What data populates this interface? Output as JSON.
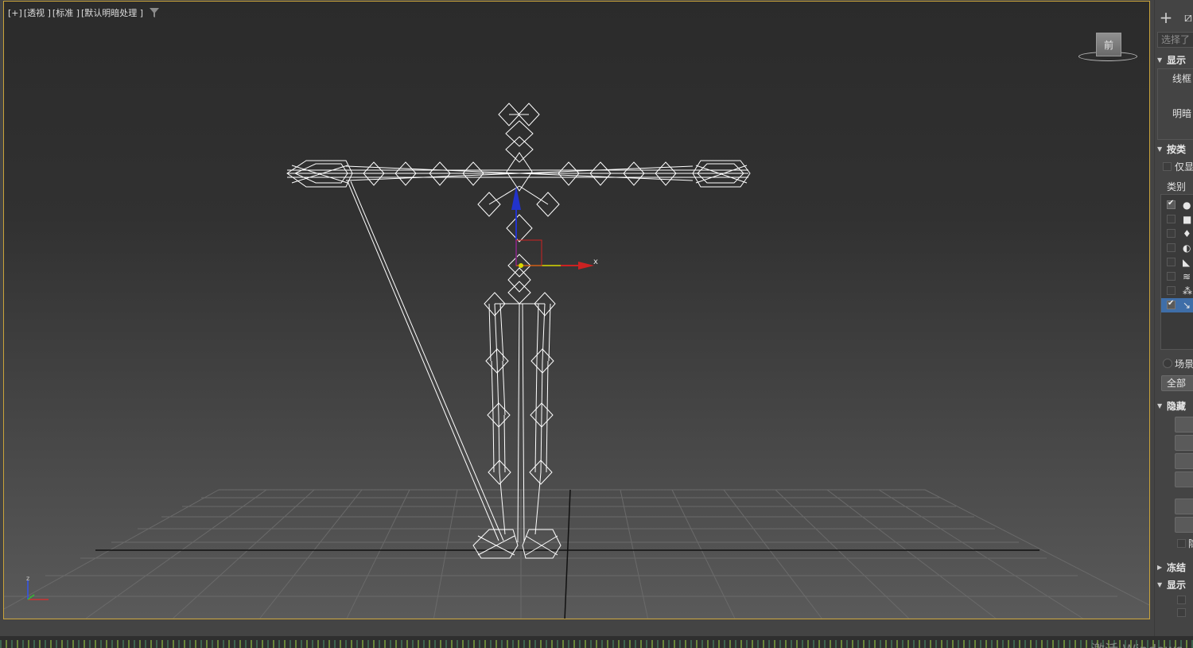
{
  "viewport": {
    "label_plus": "[+]",
    "label_view": "[透视 ]",
    "label_mode": "[标准 ]",
    "label_shading": "[默认明暗处理 ]",
    "viewcube_face": "前",
    "gizmo_axis_x": "x",
    "tripod_z": "z"
  },
  "command_panel": {
    "selection_field": "选择了",
    "display_color_header": "显示",
    "wireframe_label": "线框",
    "shaded_label": "明暗",
    "hide_by_category_header": "按类",
    "only_show_label": "仅显",
    "category_label": "类别",
    "categories": [
      {
        "icon": "geometry-sphere-icon",
        "glyph": "●",
        "checked": true,
        "selected": false
      },
      {
        "icon": "shape-icon",
        "glyph": "■",
        "checked": false,
        "selected": false
      },
      {
        "icon": "light-icon",
        "glyph": "♦",
        "checked": false,
        "selected": false
      },
      {
        "icon": "camera-icon",
        "glyph": "◐",
        "checked": false,
        "selected": false
      },
      {
        "icon": "helper-icon",
        "glyph": "◣",
        "checked": false,
        "selected": false
      },
      {
        "icon": "spacewarp-icon",
        "glyph": "≋",
        "checked": false,
        "selected": false
      },
      {
        "icon": "particle-icon",
        "glyph": "⁂",
        "checked": false,
        "selected": false
      },
      {
        "icon": "bone-icon",
        "glyph": "↘",
        "checked": true,
        "selected": true
      }
    ],
    "scene_label": "场景",
    "all_button": "全部",
    "hide_header": "隐藏",
    "hide_checkbox_label": "隐",
    "freeze_header": "冻结",
    "display_props_header": "显示"
  },
  "taskbar": {
    "watermark": "激活 Windows"
  },
  "colors": {
    "viewport_border": "#c9a33a",
    "gizmo_x": "#cc2222",
    "gizmo_y": "#d8d800",
    "gizmo_z": "#2233cc",
    "selected_row": "#3f6ea8"
  }
}
